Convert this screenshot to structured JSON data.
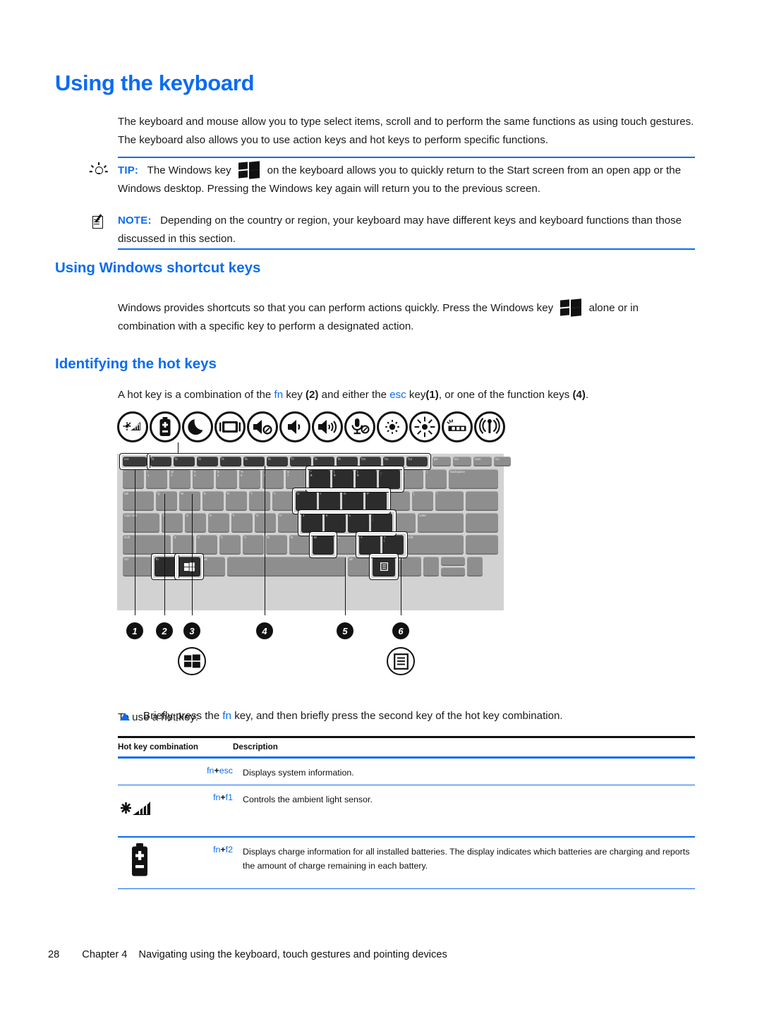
{
  "document": {
    "page_number": "28",
    "footer_chapter": "Chapter 4",
    "footer_title": "Navigating using the keyboard, touch gestures and pointing devices"
  },
  "colors": {
    "heading_blue": "#0B6CF0",
    "rule_blue": "#0B6CF0",
    "body_text": "#1a1a1a"
  },
  "headings": {
    "h1": "Using the keyboard",
    "h2_windows_shortcut": "Using Windows shortcut keys",
    "h2_identifying": "Identifying the hot keys"
  },
  "intro": {
    "text": "The keyboard and mouse allow you to type select items, scroll and to perform the same functions as using touch gestures. The keyboard also allows you to use action keys and hot keys to perform specific functions."
  },
  "tip": {
    "label": "TIP:",
    "icon": "lightbulb-icon",
    "text_before_icon": "The Windows key",
    "text_after_icon": "on the keyboard allows you to quickly return to the Start screen from an open app or the Windows desktop. Pressing the Windows key again will return you to the previous screen."
  },
  "note": {
    "label": "NOTE:",
    "icon": "notepad-icon",
    "text": "Depending on the country or region, your keyboard may have different keys and keyboard functions than those discussed in this section."
  },
  "windows_shortcut": {
    "text_before_icon": "Windows provides shortcuts so that you can perform actions quickly. Press the Windows key",
    "text_after_icon": "alone or in combination with a specific key to perform a designated action."
  },
  "hotkeys_intro": {
    "p1": "A hot key is a combination of the",
    "fn": "fn",
    "p2": "key",
    "n2": "(2)",
    "p3": "and either the",
    "esc": "esc",
    "p4": "key",
    "n1": "(1)",
    "p5": ", or one of the function keys",
    "n4": "(4)",
    "p6": "."
  },
  "figure": {
    "action_icons": [
      {
        "name": "ambient-light-sensor-icon",
        "label": "ambient light sensor"
      },
      {
        "name": "battery-icon",
        "label": "battery information"
      },
      {
        "name": "sleep-moon-icon",
        "label": "sleep"
      },
      {
        "name": "display-switch-icon",
        "label": "switch screen image"
      },
      {
        "name": "volume-mute-icon",
        "label": "mute"
      },
      {
        "name": "volume-down-icon",
        "label": "volume down"
      },
      {
        "name": "volume-up-icon",
        "label": "volume up"
      },
      {
        "name": "mic-mute-icon",
        "label": "microphone mute"
      },
      {
        "name": "brightness-down-icon",
        "label": "decrease screen brightness"
      },
      {
        "name": "brightness-up-icon",
        "label": "increase screen brightness"
      },
      {
        "name": "keyboard-backlight-icon",
        "label": "keyboard backlight"
      },
      {
        "name": "wireless-icon",
        "label": "wireless"
      }
    ],
    "callouts": [
      {
        "number": "1",
        "icon": null
      },
      {
        "number": "2",
        "icon": null
      },
      {
        "number": "3",
        "icon": "windows-logo-icon"
      },
      {
        "number": "4",
        "icon": null
      },
      {
        "number": "5",
        "icon": null
      },
      {
        "number": "6",
        "icon": "application-menu-icon"
      }
    ],
    "keyboard_labels": {
      "row_fn": [
        "esc",
        "f1",
        "f2",
        "f3",
        "f4",
        "f5",
        "f6",
        "f7",
        "f8",
        "f9",
        "f10",
        "f11",
        "f12",
        "prt sc",
        "insert",
        "num lk",
        "prt sc"
      ],
      "row_num": [
        "`",
        "1",
        "2",
        "3",
        "4",
        "5",
        "6",
        "7",
        "8",
        "9",
        "0",
        "-",
        "=",
        "backspace"
      ],
      "row_q": [
        "tab",
        "Q",
        "W",
        "E",
        "R",
        "T",
        "Y",
        "U",
        "I",
        "O",
        "P",
        "[",
        "]",
        "\\"
      ],
      "row_a": [
        "caps lock",
        "A",
        "S",
        "D",
        "F",
        "G",
        "H",
        "J",
        "K",
        "L",
        ";",
        "'",
        "enter"
      ],
      "row_z": [
        "shift",
        "Z",
        "X",
        "C",
        "V",
        "B",
        "N",
        "M",
        ",",
        ".",
        "/",
        "shift"
      ],
      "row_space": [
        "ctrl",
        "fn",
        "win",
        "alt",
        "space",
        "alt",
        "ctrl"
      ]
    }
  },
  "to_use": {
    "heading": "To use a hot key:",
    "bullet": "Briefly press the fn key, and then briefly press the second key of the hot key combination.",
    "bullet_pre": "Briefly press the",
    "bullet_fn": "fn",
    "bullet_post": "key, and then briefly press the second key of the hot key combination."
  },
  "table": {
    "headers": [
      "Hot key combination",
      "Description"
    ],
    "rows": [
      {
        "icon": null,
        "icon_name": null,
        "combo_fn": "fn",
        "combo_plus": "+",
        "combo_key": "esc",
        "description": "Displays system information."
      },
      {
        "icon": "ambient-light-sensor-icon",
        "icon_name": "ambient-light-sensor-icon",
        "combo_fn": "fn",
        "combo_plus": "+",
        "combo_key": "f1",
        "description": "Controls the ambient light sensor."
      },
      {
        "icon": "battery-icon",
        "icon_name": "battery-icon",
        "combo_fn": "fn",
        "combo_plus": "+",
        "combo_key": "f2",
        "description": "Displays charge information for all installed batteries. The display indicates which batteries are charging and reports the amount of charge remaining in each battery."
      }
    ]
  }
}
